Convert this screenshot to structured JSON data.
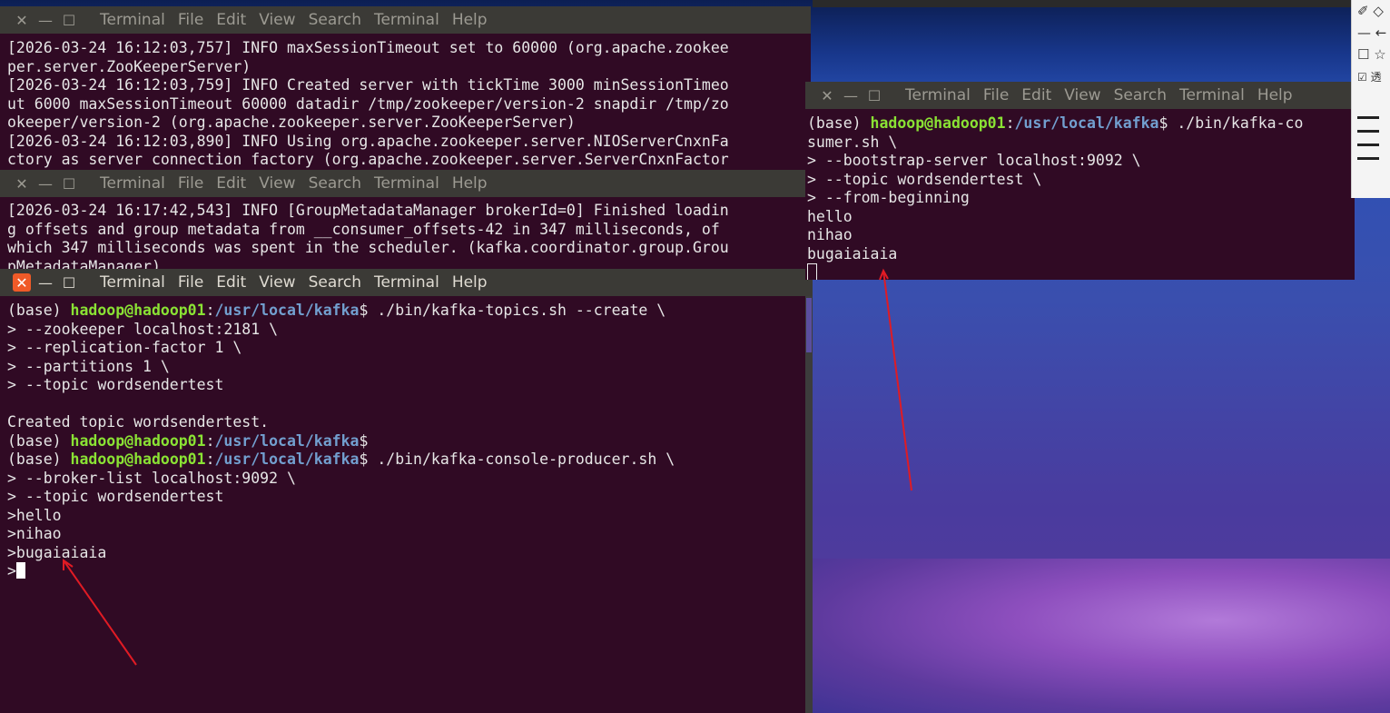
{
  "menu": [
    "Terminal",
    "File",
    "Edit",
    "View",
    "Search",
    "Terminal",
    "Help"
  ],
  "window_buttons": {
    "close": "✕",
    "minimize": "—",
    "maximize": "☐"
  },
  "terminal1": {
    "lines": [
      "[2026-03-24 16:12:03,757] INFO maxSessionTimeout set to 60000 (org.apache.zookee",
      "per.server.ZooKeeperServer)",
      "[2026-03-24 16:12:03,759] INFO Created server with tickTime 3000 minSessionTimeo",
      "ut 6000 maxSessionTimeout 60000 datadir /tmp/zookeeper/version-2 snapdir /tmp/zo",
      "okeeper/version-2 (org.apache.zookeeper.server.ZooKeeperServer)",
      "[2026-03-24 16:12:03,890] INFO Using org.apache.zookeeper.server.NIOServerCnxnFa",
      "ctory as server connection factory (org.apache.zookeeper.server.ServerCnxnFactor"
    ]
  },
  "terminal2": {
    "lines": [
      "[2026-03-24 16:17:42,543] INFO [GroupMetadataManager brokerId=0] Finished loadin",
      "g offsets and group metadata from __consumer_offsets-42 in 347 milliseconds, of",
      "which 347 milliseconds was spent in the scheduler. (kafka.coordinator.group.Grou",
      "pMetadataManager)"
    ]
  },
  "prompt": {
    "env": "(base) ",
    "user": "hadoop@hadoop01",
    "sep": ":",
    "path": "/usr/local/kafka",
    "dollar": "$"
  },
  "terminal3": {
    "cmd1": " ./bin/kafka-topics.sh --create \\",
    "cont1": [
      "> --zookeeper localhost:2181 \\",
      "> --replication-factor 1 \\",
      "> --partitions 1 \\",
      "> --topic wordsendertest",
      "",
      "Created topic wordsendertest."
    ],
    "cmd3": " ./bin/kafka-console-producer.sh \\",
    "cont2": [
      "> --broker-list localhost:9092 \\",
      "> --topic wordsendertest",
      ">hello",
      ">nihao",
      ">bugaiaiaia"
    ],
    "last_prompt": ">"
  },
  "terminal4": {
    "cmd": " ./bin/kafka-co",
    "cmd_wrap": "sumer.sh \\",
    "lines": [
      "> --bootstrap-server localhost:9092 \\",
      "> --topic wordsendertest \\",
      "> --from-beginning",
      "hello",
      "nihao",
      "bugaiaiaia"
    ]
  },
  "sidepanel": {
    "row1": "✐ ◇",
    "row2": "— ←",
    "row3": "☐ ☆",
    "row4": "☑ 透"
  },
  "colors": {
    "terminal_bg": "#300a24",
    "prompt_user": "#8ae234",
    "prompt_path": "#729fcf",
    "arrow": "#e01b24"
  }
}
